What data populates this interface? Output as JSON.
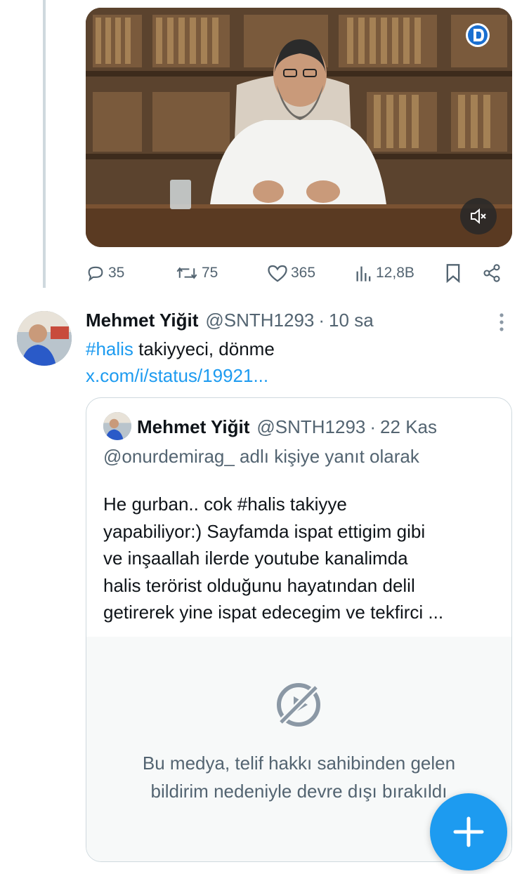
{
  "video": {
    "mute_icon": "speaker-muted-icon",
    "channel_logo_icon": "channel-logo-icon"
  },
  "actions": {
    "replies": "35",
    "retweets": "75",
    "likes": "365",
    "views": "12,8B",
    "icons": [
      "reply-icon",
      "retweet-icon",
      "heart-icon",
      "views-icon",
      "bookmark-icon",
      "share-icon"
    ]
  },
  "reply_tweet": {
    "name": "Mehmet Yiğit",
    "handle": "@SNTH1293",
    "separator": "·",
    "time": "10 sa",
    "hashtag": "#halis",
    "text": " takiyyeci, dönme",
    "link": "x.com/i/status/19921..."
  },
  "quote_tweet": {
    "name": "Mehmet Yiğit",
    "handle": "@SNTH1293",
    "separator": "·",
    "date": "22 Kas",
    "reply_to": "@onurdemirag_ adlı kişiye yanıt olarak",
    "text_lines": [
      "He gurban..  cok #halis takiyye",
      "yapabiliyor:) Sayfamda ispat ettigim gibi",
      "ve inşaallah ilerde youtube kanalimda",
      "halis terörist olduğunu hayatından delil",
      "getirerek yine ispat edecegim ve tekfirci ..."
    ],
    "media_disabled_line1": "Bu medya, telif hakkı sahibinden gelen",
    "media_disabled_line2": "bildirim nedeniyle devre dışı bırakıldı"
  },
  "fab": {
    "icon": "plus-icon"
  },
  "colors": {
    "accent": "#1d9bf0",
    "muted": "#536471",
    "border": "#cfd9de"
  }
}
